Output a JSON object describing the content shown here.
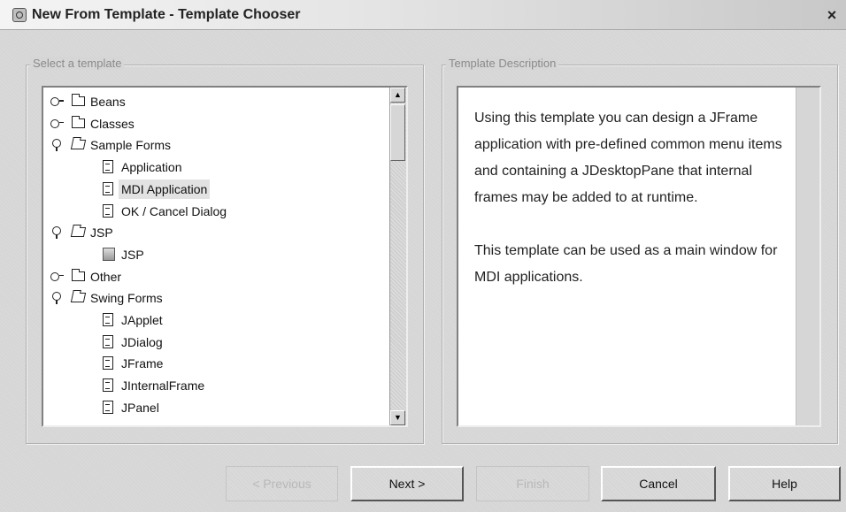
{
  "window": {
    "title": "New From Template - Template Chooser",
    "close": "×"
  },
  "select_group": {
    "label": "Select a template"
  },
  "description_group": {
    "label": "Template Description"
  },
  "tree": [
    {
      "label": "Beans",
      "level": 0,
      "kind": "folder",
      "state": "collapsed"
    },
    {
      "label": "Classes",
      "level": 0,
      "kind": "folder",
      "state": "collapsed"
    },
    {
      "label": "Sample Forms",
      "level": 0,
      "kind": "folder",
      "state": "expanded"
    },
    {
      "label": "Application",
      "level": 1,
      "kind": "doc"
    },
    {
      "label": "MDI Application",
      "level": 1,
      "kind": "doc",
      "selected": true
    },
    {
      "label": "OK / Cancel Dialog",
      "level": 1,
      "kind": "doc"
    },
    {
      "label": "JSP",
      "level": 0,
      "kind": "folder",
      "state": "expanded"
    },
    {
      "label": "JSP",
      "level": 1,
      "kind": "jsp"
    },
    {
      "label": "Other",
      "level": 0,
      "kind": "folder",
      "state": "collapsed"
    },
    {
      "label": "Swing Forms",
      "level": 0,
      "kind": "folder",
      "state": "expanded"
    },
    {
      "label": "JApplet",
      "level": 1,
      "kind": "doc"
    },
    {
      "label": "JDialog",
      "level": 1,
      "kind": "doc"
    },
    {
      "label": "JFrame",
      "level": 1,
      "kind": "doc"
    },
    {
      "label": "JInternalFrame",
      "level": 1,
      "kind": "doc"
    },
    {
      "label": "JPanel",
      "level": 1,
      "kind": "doc"
    }
  ],
  "description": {
    "p1": "Using this template you can design a JFrame application with pre-defined common menu items and containing a JDesktopPane that internal frames may be added to at runtime.",
    "p2": "This template can be used as a main window for MDI applications."
  },
  "buttons": {
    "previous": "< Previous",
    "next": "Next >",
    "finish": "Finish",
    "cancel": "Cancel",
    "help": "Help"
  }
}
